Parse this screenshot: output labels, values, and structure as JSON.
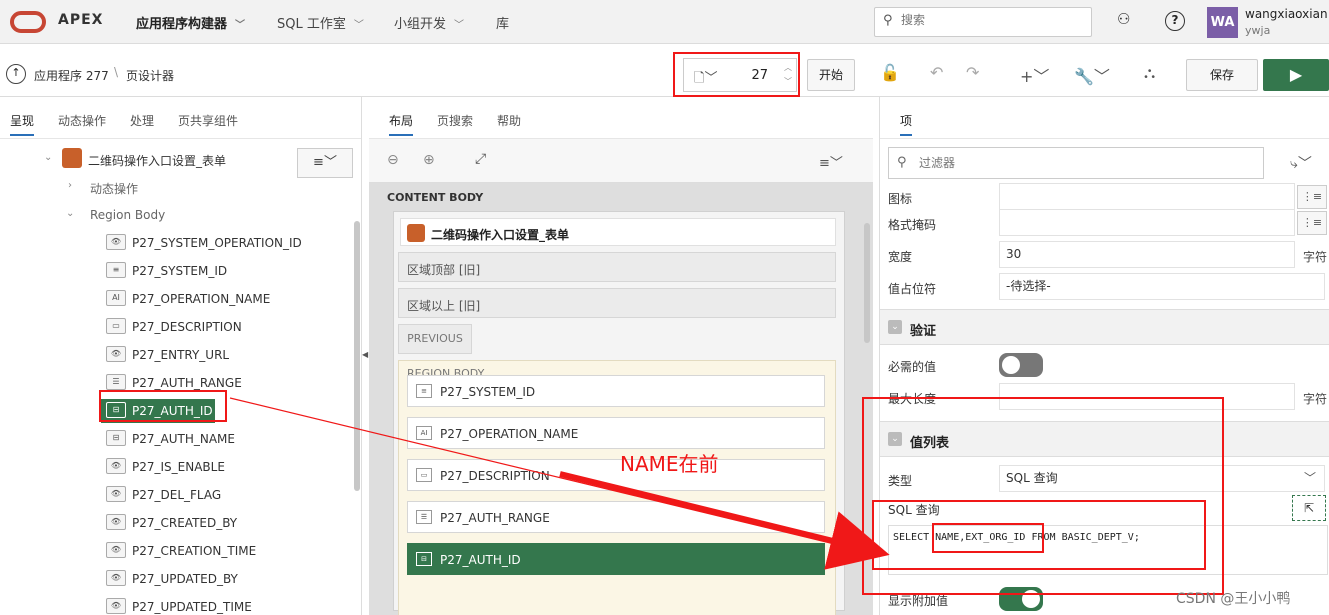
{
  "topbar": {
    "brand": "APEX",
    "nav": [
      {
        "label": "应用程序构建器",
        "dropdown": true,
        "active": true
      },
      {
        "label": "SQL 工作室",
        "dropdown": true,
        "active": false
      },
      {
        "label": "小组开发",
        "dropdown": true,
        "active": false
      },
      {
        "label": "库",
        "dropdown": false,
        "active": false
      }
    ],
    "search_placeholder": "搜索",
    "user": {
      "initials": "WA",
      "name": "wangxiaoxian",
      "workspace": "ywja"
    }
  },
  "toolbar": {
    "breadcrumb_app": "应用程序 277",
    "breadcrumb_page": "页设计器",
    "page_number": "27",
    "start_label": "开始",
    "save_label": "保存"
  },
  "left_panel": {
    "tabs": [
      "呈现",
      "动态操作",
      "处理",
      "页共享组件"
    ],
    "region_name": "二维码操作入口设置_表单",
    "dynamic_actions": "动态操作",
    "region_body": "Region Body",
    "items": [
      {
        "label": "P27_SYSTEM_OPERATION_ID",
        "icon": "hidden-icon"
      },
      {
        "label": "P27_SYSTEM_ID",
        "icon": "select-list-icon"
      },
      {
        "label": "P27_OPERATION_NAME",
        "icon": "text-field-icon"
      },
      {
        "label": "P27_DESCRIPTION",
        "icon": "textarea-icon"
      },
      {
        "label": "P27_ENTRY_URL",
        "icon": "hidden-icon"
      },
      {
        "label": "P27_AUTH_RANGE",
        "icon": "checkbox-icon"
      },
      {
        "label": "P27_AUTH_ID",
        "icon": "popup-lov-icon"
      },
      {
        "label": "P27_AUTH_NAME",
        "icon": "popup-lov-icon"
      },
      {
        "label": "P27_IS_ENABLE",
        "icon": "hidden-icon"
      },
      {
        "label": "P27_DEL_FLAG",
        "icon": "hidden-icon"
      },
      {
        "label": "P27_CREATED_BY",
        "icon": "hidden-icon"
      },
      {
        "label": "P27_CREATION_TIME",
        "icon": "hidden-icon"
      },
      {
        "label": "P27_UPDATED_BY",
        "icon": "hidden-icon"
      },
      {
        "label": "P27_UPDATED_TIME",
        "icon": "hidden-icon"
      }
    ]
  },
  "mid_panel": {
    "tabs": [
      "布局",
      "页搜索",
      "帮助"
    ],
    "content_body": "CONTENT BODY",
    "region_title": "二维码操作入口设置_表单",
    "slot_top": "区域顶部 [旧]",
    "slot_above": "区域以上 [旧]",
    "previous": "PREVIOUS",
    "region_body": "REGION BODY",
    "items": [
      {
        "label": "P27_SYSTEM_ID",
        "icon": "select-list-icon"
      },
      {
        "label": "P27_OPERATION_NAME",
        "icon": "text-field-icon"
      },
      {
        "label": "P27_DESCRIPTION",
        "icon": "textarea-icon"
      },
      {
        "label": "P27_AUTH_RANGE",
        "icon": "checkbox-icon"
      },
      {
        "label": "P27_AUTH_ID",
        "icon": "popup-lov-icon"
      }
    ]
  },
  "right_panel": {
    "tab": "项",
    "filter_placeholder": "过滤器",
    "props_top": [
      {
        "label": "图标",
        "value": ""
      },
      {
        "label": "格式掩码",
        "value": ""
      },
      {
        "label": "宽度",
        "value": "30",
        "unit": "字符"
      },
      {
        "label": "值占位符",
        "value": "-待选择-"
      }
    ],
    "validation_group": "验证",
    "required_label": "必需的值",
    "required_on": false,
    "maxlen_label": "最大长度",
    "maxlen_unit": "字符",
    "lov_group": "值列表",
    "type_label": "类型",
    "type_value": "SQL 查询",
    "sql_label": "SQL 查询",
    "sql_value": "SELECT NAME,EXT_ORG_ID FROM BASIC_DEPT_V;",
    "extra_label": "显示附加值",
    "extra_on": true
  },
  "annotation": "NAME在前",
  "watermark": "CSDN @王小小鸭",
  "colors": {
    "selected": "#34774d",
    "annotation": "#f01818",
    "oracle_red": "#c74634"
  }
}
